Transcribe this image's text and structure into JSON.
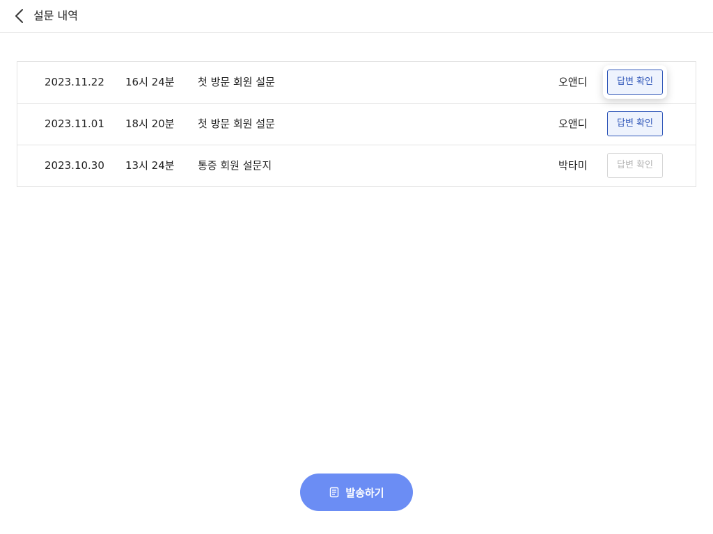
{
  "header": {
    "title": "설문 내역"
  },
  "surveys": [
    {
      "date": "2023.11.22",
      "time": "16시 24분",
      "title": "첫 방문 회원 설문",
      "author": "오앤디",
      "button_label": "답변 확인",
      "button_enabled": true,
      "button_focused": true
    },
    {
      "date": "2023.11.01",
      "time": "18시 20분",
      "title": "첫 방문 회원 설문",
      "author": "오앤디",
      "button_label": "답변 확인",
      "button_enabled": true,
      "button_focused": false
    },
    {
      "date": "2023.10.30",
      "time": "13시 24분",
      "title": "통증 회원 설문지",
      "author": "박타미",
      "button_label": "답변 확인",
      "button_enabled": false,
      "button_focused": false
    }
  ],
  "send_button": {
    "label": "발송하기",
    "icon": "document-icon",
    "color": "#6b8df4"
  },
  "colors": {
    "accent": "#2f56b8",
    "accent_bg": "#eef3fd",
    "disabled_text": "#b5b5b5"
  }
}
